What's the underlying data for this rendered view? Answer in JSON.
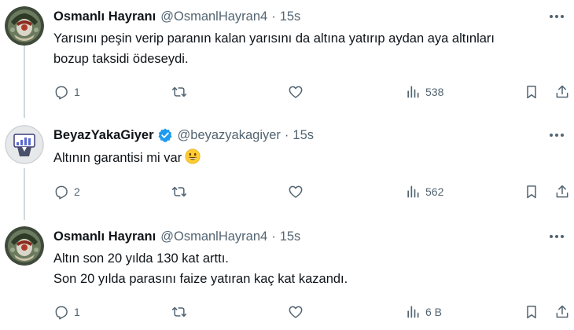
{
  "tweets": [
    {
      "name": "Osmanlı Hayranı",
      "handle": "@OsmanlHayran4",
      "separator": "·",
      "time": "15s",
      "lines": [
        "Yarısını peşin verip paranın kalan yarısını da altına yatırıp aydan aya altınları",
        "bozup taksidi ödeseydi."
      ],
      "reply_count": "1",
      "retweet_count": "",
      "like_count": "",
      "view_count": "538"
    },
    {
      "name": "BeyazYakaGiyer",
      "handle": "@beyazyakagiyer",
      "separator": "·",
      "time": "15s",
      "lines": [
        "Altının garantisi mi var"
      ],
      "emoji": "grinning-face-emoji",
      "reply_count": "2",
      "retweet_count": "",
      "like_count": "",
      "view_count": "562"
    },
    {
      "name": "Osmanlı Hayranı",
      "handle": "@OsmanlHayran4",
      "separator": "·",
      "time": "15s",
      "lines": [
        "Altın son 20 yılda 130 kat arttı.",
        "Son 20 yılda parasını faize yatıran kaç kat kazandı."
      ],
      "reply_count": "1",
      "retweet_count": "",
      "like_count": "",
      "view_count": "6 B"
    }
  ],
  "colors": {
    "text": "#0f1419",
    "secondary": "#536471",
    "verified": "#1d9bf0",
    "thread_line": "#cfd9de"
  }
}
